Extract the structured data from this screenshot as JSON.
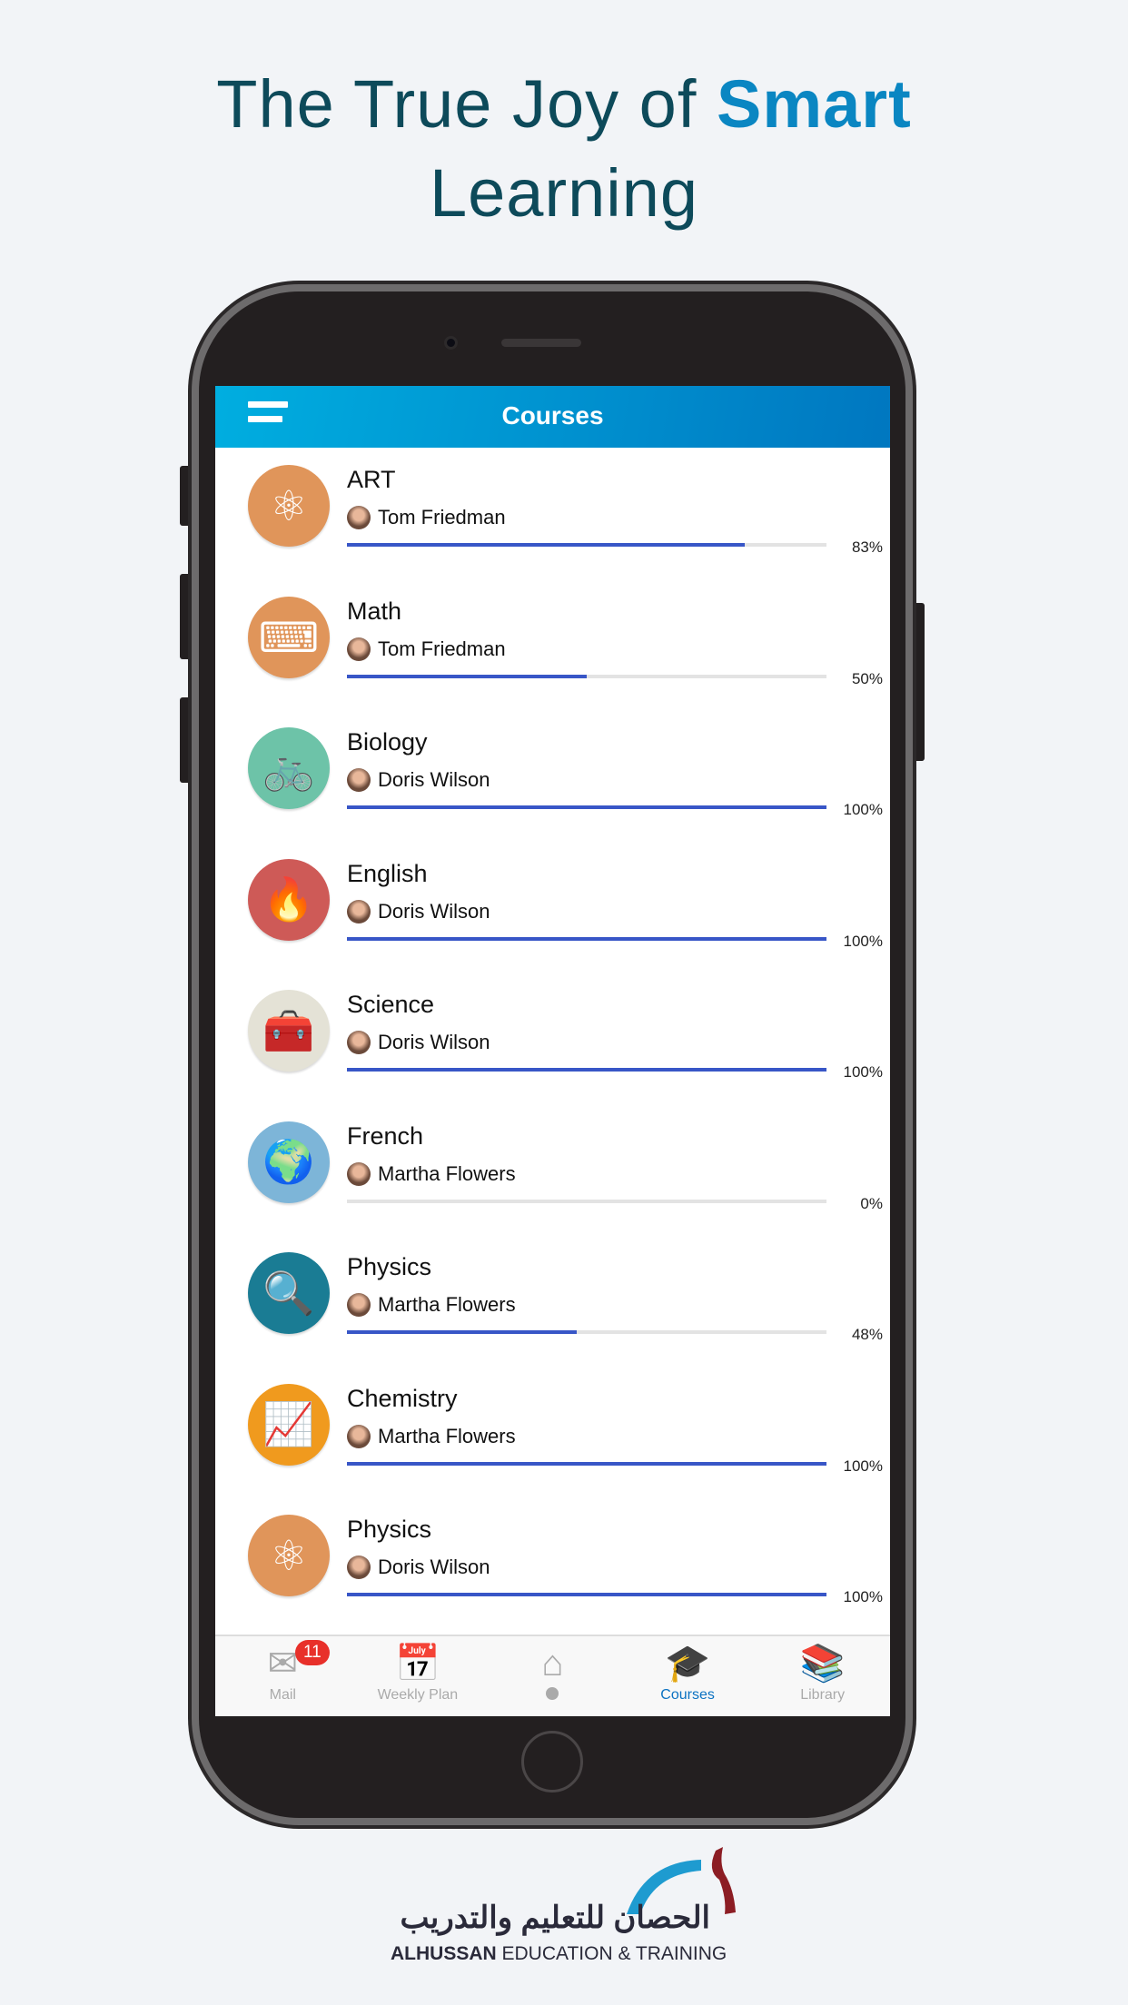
{
  "headline": {
    "line1_prefix": "The True Joy of ",
    "line1_highlight": "Smart",
    "line2": "Learning"
  },
  "header": {
    "title": "Courses",
    "menu_icon": "hamburger-icon"
  },
  "courses": [
    {
      "title": "ART",
      "teacher": "Tom Friedman",
      "progress": 83,
      "progress_label": "83%",
      "icon": "atom-icon",
      "color": "#E0955A",
      "glyph": "⚛"
    },
    {
      "title": "Math",
      "teacher": "Tom Friedman",
      "progress": 50,
      "progress_label": "50%",
      "icon": "keyboard-icon",
      "color": "#E0955A",
      "glyph": "⌨"
    },
    {
      "title": "Biology",
      "teacher": "Doris Wilson",
      "progress": 100,
      "progress_label": "100%",
      "icon": "bicycle-icon",
      "color": "#6DC3A8",
      "glyph": "🚲"
    },
    {
      "title": "English",
      "teacher": "Doris Wilson",
      "progress": 100,
      "progress_label": "100%",
      "icon": "flame-icon",
      "color": "#CE5A57",
      "glyph": "🔥"
    },
    {
      "title": "Science",
      "teacher": "Doris Wilson",
      "progress": 100,
      "progress_label": "100%",
      "icon": "toolbox-icon",
      "color": "#E4E2D6",
      "glyph": "🧰"
    },
    {
      "title": "French",
      "teacher": "Martha Flowers",
      "progress": 0,
      "progress_label": "0%",
      "icon": "globe-icon",
      "color": "#7DB5D8",
      "glyph": "🌍"
    },
    {
      "title": "Physics",
      "teacher": "Martha Flowers",
      "progress": 48,
      "progress_label": "48%",
      "icon": "magnifier-icon",
      "color": "#1A7C94",
      "glyph": "🔍"
    },
    {
      "title": "Chemistry",
      "teacher": "Martha Flowers",
      "progress": 100,
      "progress_label": "100%",
      "icon": "line-chart-icon",
      "color": "#F09A1E",
      "glyph": "📈"
    },
    {
      "title": "Physics",
      "teacher": "Doris Wilson",
      "progress": 100,
      "progress_label": "100%",
      "icon": "atom-icon",
      "color": "#E0955A",
      "glyph": "⚛"
    }
  ],
  "tabs": [
    {
      "label": "Mail",
      "icon": "mail-icon",
      "glyph": "✉",
      "badge": "11"
    },
    {
      "label": "Weekly Plan",
      "icon": "calendar-icon",
      "glyph": "📅"
    },
    {
      "label": "",
      "icon": "home-icon",
      "glyph": "⌂"
    },
    {
      "label": "Courses",
      "icon": "graduation-cap-icon",
      "glyph": "🎓",
      "active": true
    },
    {
      "label": "Library",
      "icon": "books-icon",
      "glyph": "📚"
    }
  ],
  "colors": {
    "accent": "#0a86c2",
    "progress": "#3856c7",
    "badge": "#e8302a"
  },
  "logo": {
    "arabic": "الحصان للتعليم والتدريب",
    "brand": "ALHUSSAN",
    "rest": " EDUCATION & TRAINING"
  }
}
